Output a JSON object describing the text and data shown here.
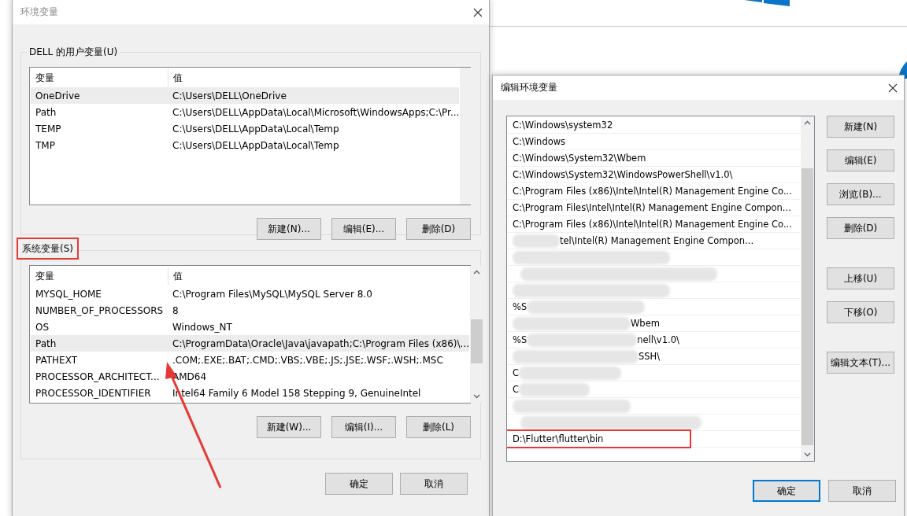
{
  "env_dialog": {
    "title": "环境变量",
    "user_group": {
      "label": "DELL 的用户变量(U)",
      "highlighted": false,
      "columns": [
        "变量",
        "值"
      ],
      "rows": [
        {
          "name": "OneDrive",
          "value": "C:\\Users\\DELL\\OneDrive",
          "selected": true
        },
        {
          "name": "Path",
          "value": "C:\\Users\\DELL\\AppData\\Local\\Microsoft\\WindowsApps;C:\\Pr...",
          "selected": false
        },
        {
          "name": "TEMP",
          "value": "C:\\Users\\DELL\\AppData\\Local\\Temp",
          "selected": false
        },
        {
          "name": "TMP",
          "value": "C:\\Users\\DELL\\AppData\\Local\\Temp",
          "selected": false
        }
      ],
      "buttons": [
        "新建(N)...",
        "编辑(E)...",
        "删除(D)"
      ]
    },
    "system_group": {
      "label": "系统变量(S)",
      "highlighted": true,
      "columns": [
        "变量",
        "值"
      ],
      "rows": [
        {
          "name": "MYSQL_HOME",
          "value": "C:\\Program Files\\MySQL\\MySQL Server 8.0",
          "selected": false
        },
        {
          "name": "NUMBER_OF_PROCESSORS",
          "value": "8",
          "selected": false
        },
        {
          "name": "OS",
          "value": "Windows_NT",
          "selected": false
        },
        {
          "name": "Path",
          "value": "C:\\ProgramData\\Oracle\\Java\\javapath;C:\\Program Files (x86)\\...",
          "selected": true
        },
        {
          "name": "PATHEXT",
          "value": ".COM;.EXE;.BAT;.CMD;.VBS;.VBE;.JS;.JSE;.WSF;.WSH;.MSC",
          "selected": false
        },
        {
          "name": "PROCESSOR_ARCHITECT...",
          "value": "AMD64",
          "selected": false
        },
        {
          "name": "PROCESSOR_IDENTIFIER",
          "value": "Intel64 Family 6 Model 158 Stepping 9, GenuineIntel",
          "selected": false
        }
      ],
      "buttons": [
        "新建(W)...",
        "编辑(I)...",
        "删除(L)"
      ]
    },
    "buttons": [
      {
        "label": "确定",
        "default": false
      },
      {
        "label": "取消",
        "default": false
      }
    ]
  },
  "edit_dialog": {
    "title": "编辑环境变量",
    "entries": [
      {
        "kind": "text",
        "text": "C:\\Windows\\system32",
        "highlighted": false
      },
      {
        "kind": "text",
        "text": "C:\\Windows",
        "highlighted": false
      },
      {
        "kind": "text",
        "text": "C:\\Windows\\System32\\Wbem",
        "highlighted": false
      },
      {
        "kind": "text",
        "text": "C:\\Windows\\System32\\WindowsPowerShell\\v1.0\\",
        "highlighted": false
      },
      {
        "kind": "text",
        "text": "C:\\Program Files (x86)\\Intel\\Intel(R) Management Engine Co...",
        "highlighted": false
      },
      {
        "kind": "text",
        "text": "C:\\Program Files\\Intel\\Intel(R) Management Engine Compon...",
        "highlighted": false
      },
      {
        "kind": "text",
        "text": "C:\\Program Files (x86)\\Intel\\Intel(R) Management Engine Co...",
        "highlighted": false
      },
      {
        "kind": "redacted",
        "right": "tel\\Intel(R) Management Engine Compon..."
      },
      {
        "kind": "redacted"
      },
      {
        "kind": "redacted"
      },
      {
        "kind": "redacted"
      },
      {
        "kind": "redacted",
        "left": "%S"
      },
      {
        "kind": "redacted",
        "right": "Wbem"
      },
      {
        "kind": "redacted",
        "left": "%S",
        "right": "nell\\v1.0\\"
      },
      {
        "kind": "redacted",
        "right": "SSH\\"
      },
      {
        "kind": "redacted",
        "left": "C"
      },
      {
        "kind": "redacted",
        "left": "C"
      },
      {
        "kind": "redacted"
      },
      {
        "kind": "redacted"
      },
      {
        "kind": "text",
        "text": "D:\\Flutter\\flutter\\bin",
        "highlighted": true
      }
    ],
    "side_button_groups": [
      [
        "新建(N)",
        "编辑(E)",
        "浏览(B)...",
        "删除(D)"
      ],
      [
        "上移(U)",
        "下移(O)"
      ],
      [
        "编辑文本(T)..."
      ]
    ],
    "buttons": [
      {
        "label": "确定",
        "default": true
      },
      {
        "label": "取消",
        "default": false
      }
    ]
  }
}
